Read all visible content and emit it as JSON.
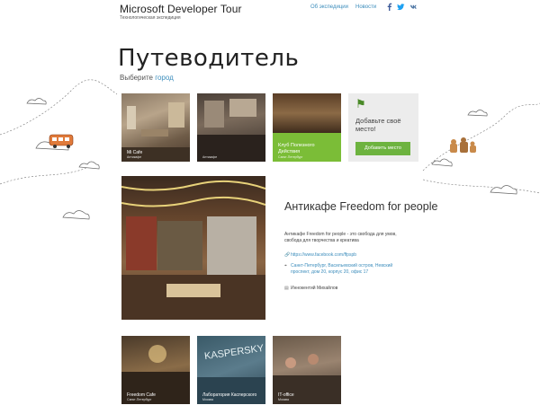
{
  "header": {
    "title": "Microsoft Developer Tour",
    "subtitle": "Технологическая экспедиция",
    "nav": [
      "Об экспедиции",
      "Новости"
    ],
    "social": [
      "facebook-icon",
      "twitter-icon",
      "vk-icon"
    ]
  },
  "page_title": "Путеводитель",
  "choose": {
    "prefix": "Выберите ",
    "link": "город"
  },
  "tiles": [
    {
      "title": "Mi Cafe",
      "sub": "Антикафе"
    },
    {
      "title": "",
      "sub": "Антикафе"
    },
    {
      "title": "Клуб Полезного Действия",
      "sub": "Санкт-Петербург"
    }
  ],
  "add_place": {
    "text": "Добавьте своё место!",
    "button": "Добавить место"
  },
  "feature": {
    "title": "Антикафе Freedom for people",
    "description": "Антикафе Freedom for people - это свобода для умов, свобода для творчества и креатива",
    "link": "https://www.facebook.com/ffpspb",
    "address": "Санкт-Петербург, Васильевский остров, Невский проспект, дом 20, корпус 20, офис 17",
    "person": "Иннокентий Михайлов"
  },
  "bottom_tiles": [
    {
      "title": "Freedom Cafe",
      "sub": "Санкт-Петербург"
    },
    {
      "title": "Лаборатория Касперского",
      "sub": "Москва"
    },
    {
      "title": "IT-office",
      "sub": "Москва"
    }
  ],
  "colors": {
    "accent": "#3c8dbc",
    "green": "#7bbd37"
  }
}
